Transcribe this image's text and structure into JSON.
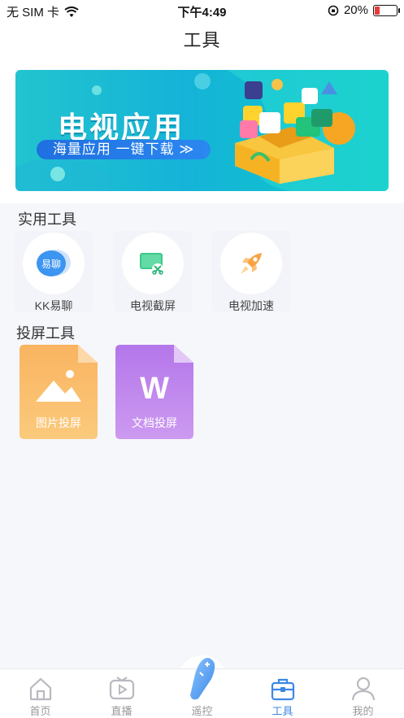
{
  "status_bar": {
    "carrier": "无 SIM 卡",
    "time": "下午4:49",
    "battery": "20%",
    "battery_level": 0.2
  },
  "header": {
    "title": "工具"
  },
  "banner": {
    "title": "电视应用",
    "subtitle": "海量应用 一键下载 ≫"
  },
  "utility_tools": {
    "title": "实用工具",
    "items": [
      {
        "label": "KK易聊",
        "icon": "chat-bubble-icon",
        "icon_text": "易聊"
      },
      {
        "label": "电视截屏",
        "icon": "screenshot-icon"
      },
      {
        "label": "电视加速",
        "icon": "rocket-icon"
      }
    ]
  },
  "cast_tools": {
    "title": "投屏工具",
    "items": [
      {
        "label": "图片投屏",
        "icon": "image-file-icon"
      },
      {
        "label": "文档投屏",
        "icon": "word-file-icon",
        "icon_text": "W"
      }
    ]
  },
  "tab_bar": {
    "tabs": [
      {
        "label": "首页",
        "icon": "home-icon"
      },
      {
        "label": "直播",
        "icon": "tv-play-icon"
      },
      {
        "label": "遥控",
        "icon": "remote-icon"
      },
      {
        "label": "工具",
        "icon": "toolbox-icon",
        "active": true
      },
      {
        "label": "我的",
        "icon": "user-icon"
      }
    ]
  },
  "colors": {
    "accent": "#3c87e6",
    "banner_start": "#22c4cf",
    "photo_card": "#f7b35f",
    "doc_card": "#b57de8"
  }
}
